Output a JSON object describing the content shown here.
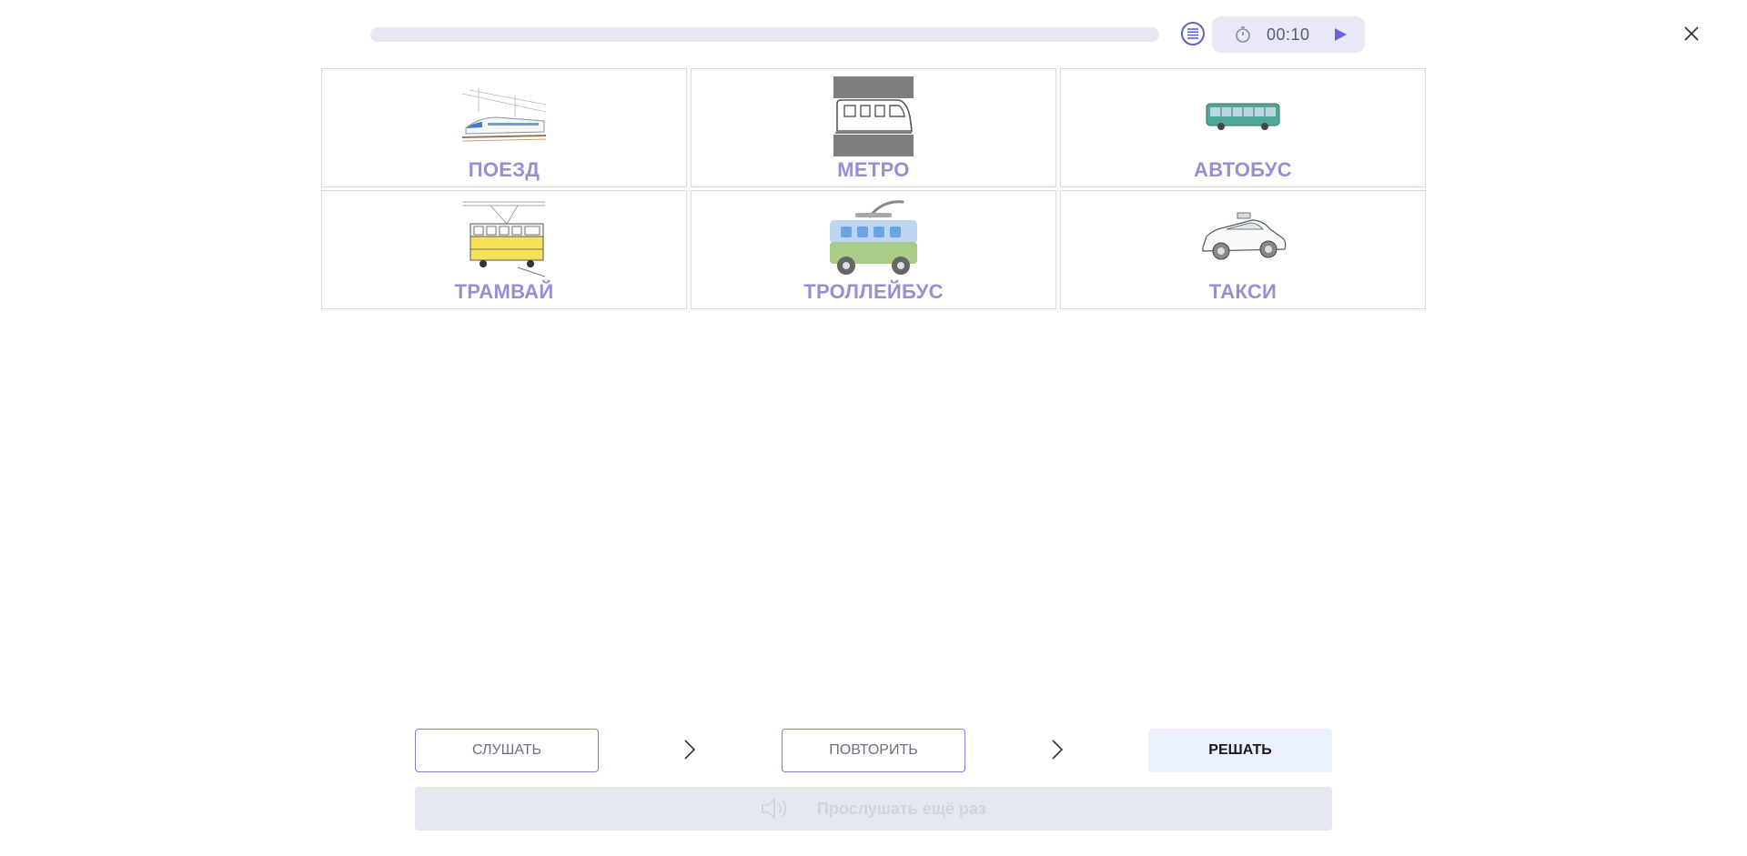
{
  "topbar": {
    "timer": "00:10",
    "icons": {
      "list": "list-icon",
      "clock": "stopwatch-icon",
      "play": "play-icon",
      "close": "close-icon"
    },
    "colors": {
      "accent": "#5b63c8",
      "track": "#e7e6f4"
    }
  },
  "cards": [
    {
      "label": "ПОЕЗД",
      "icon": "train-icon"
    },
    {
      "label": "МЕТРО",
      "icon": "metro-icon"
    },
    {
      "label": "АВТОБУС",
      "icon": "bus-icon"
    },
    {
      "label": "ТРАМВАЙ",
      "icon": "tram-icon"
    },
    {
      "label": "ТРОЛЛЕЙБУС",
      "icon": "trolleybus-icon"
    },
    {
      "label": "ТАКСИ",
      "icon": "taxi-icon"
    }
  ],
  "steps": {
    "listen": "СЛУШАТЬ",
    "repeat": "ПОВТОРИТЬ",
    "solve": "РЕШАТЬ"
  },
  "replay": {
    "label": "Прослушать ещё раз",
    "icon": "speaker-icon"
  }
}
